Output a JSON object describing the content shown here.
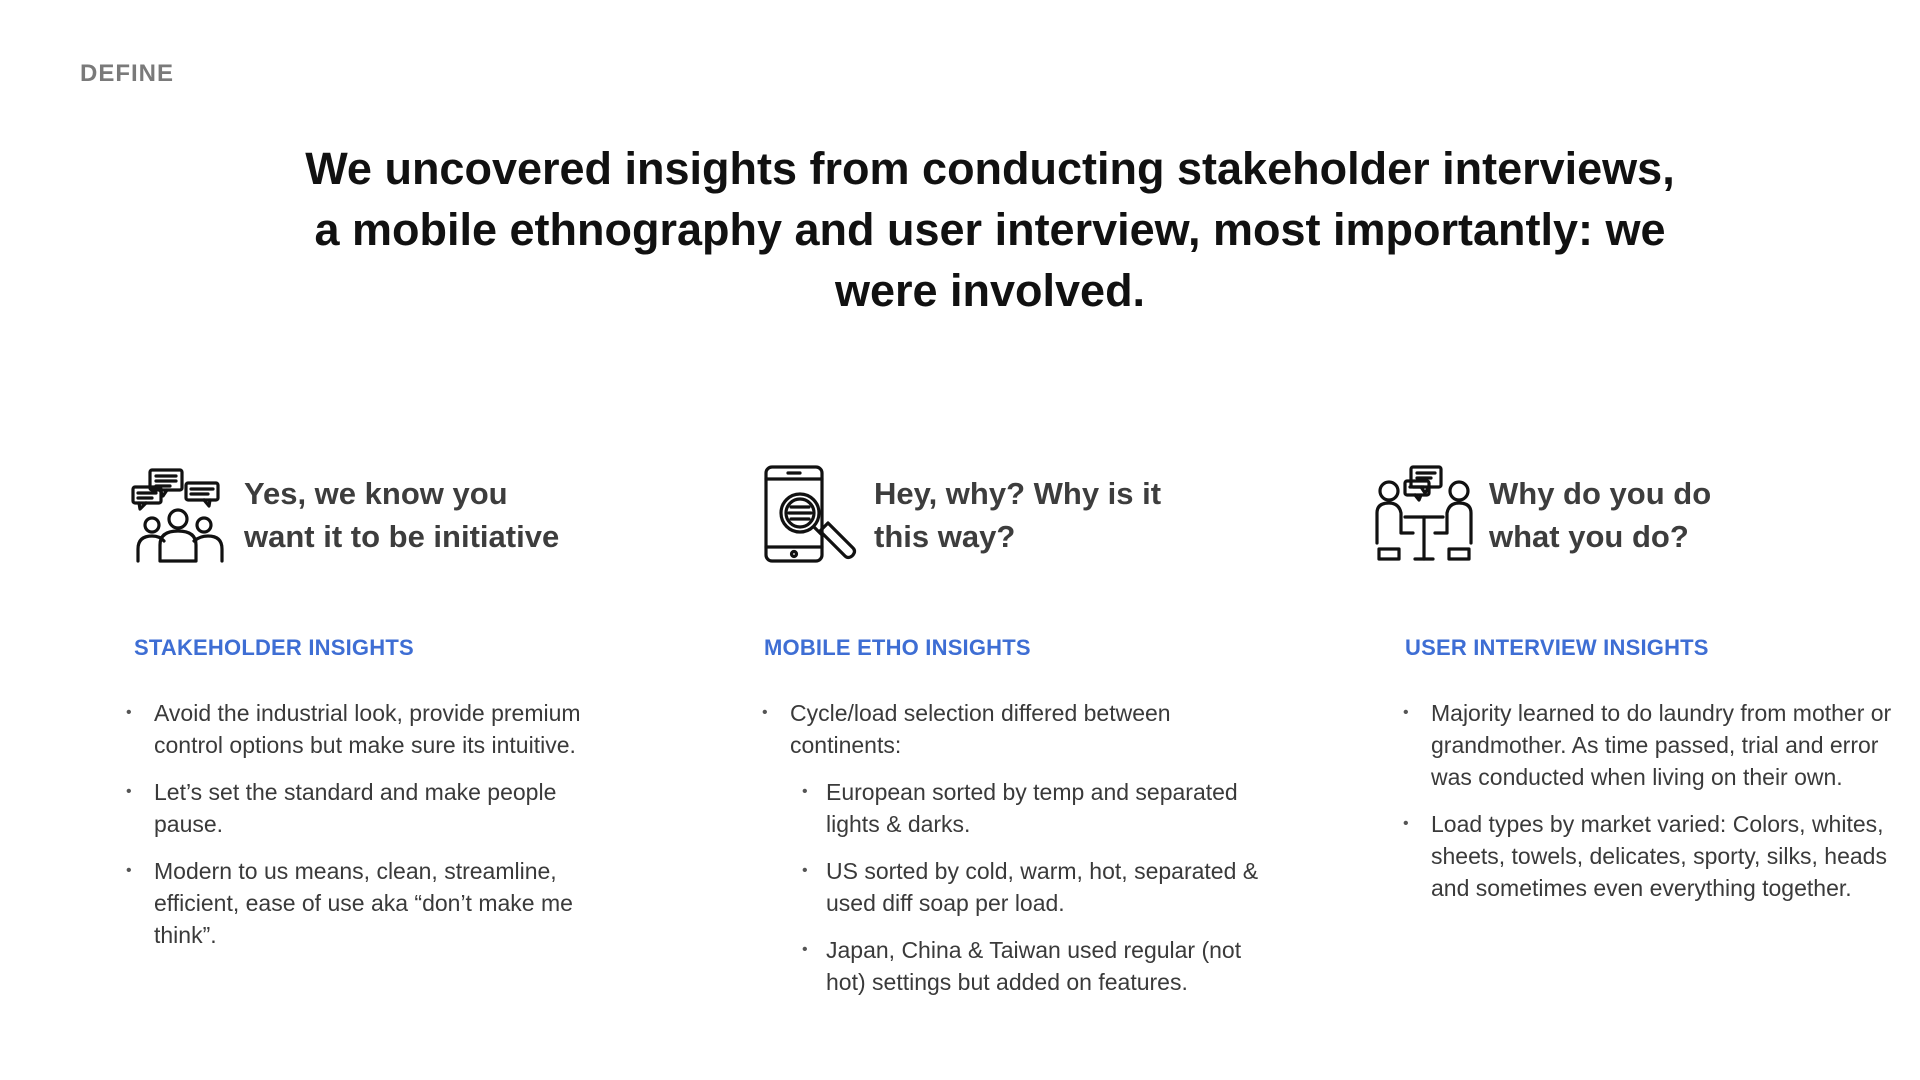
{
  "section_label": "DEFINE",
  "headline": "We uncovered insights from conducting stakeholder interviews, a mobile ethnography and user interview, most importantly: we were involved.",
  "columns": [
    {
      "icon": "group-chat-icon",
      "title": "Yes, we know you\nwant it to be initiative",
      "label": "STAKEHOLDER INSIGHTS",
      "bullets": [
        "Avoid the industrial look, provide premium control options but make sure its intuitive.",
        "Let’s set the standard and make people pause.",
        "Modern to us means, clean, streamline, efficient, ease of use aka “don’t make me think”."
      ]
    },
    {
      "icon": "mobile-search-icon",
      "title": "Hey, why? Why is it\nthis way?",
      "label": "MOBILE ETHO INSIGHTS",
      "bullets": [
        "Cycle/load selection differed between continents:"
      ],
      "sub_bullets": [
        "European sorted by temp and separated lights & darks.",
        "US sorted by cold, warm, hot, separated & used diff soap per load.",
        "Japan, China & Taiwan used regular (not hot) settings but added on features."
      ]
    },
    {
      "icon": "interview-icon",
      "title": "Why do you do\nwhat you do?",
      "label": "USER INTERVIEW INSIGHTS",
      "bullets": [
        "Majority learned to do laundry from mother or grandmother. As time passed, trial and error was conducted when living on their own.",
        "Load types by market varied: Colors, whites, sheets, towels, delicates, sporty, silks, heads and sometimes even everything together."
      ]
    }
  ],
  "colors": {
    "accent": "#3e6ed4",
    "headline": "#111111",
    "body": "#3a3a3a",
    "section_label": "#7a7a7a"
  }
}
